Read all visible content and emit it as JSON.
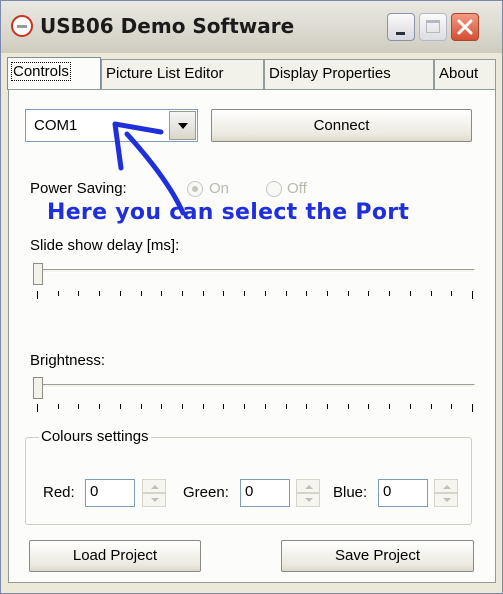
{
  "window": {
    "title": "USB06 Demo Software",
    "controls": {
      "minimize_icon": "minimize-icon",
      "maximize_icon": "maximize-icon",
      "close_icon": "close-icon"
    }
  },
  "tabs": [
    {
      "label": "Controls",
      "active": true
    },
    {
      "label": "Picture List Editor",
      "active": false
    },
    {
      "label": "Display Properties",
      "active": false
    },
    {
      "label": "About",
      "active": false
    }
  ],
  "port": {
    "selected": "COM1",
    "connect_label": "Connect"
  },
  "power_saving": {
    "label": "Power Saving:",
    "on_label": "On",
    "off_label": "Off",
    "selected": "On",
    "enabled": false
  },
  "annotation": {
    "text": "Here you can select the Port",
    "color": "#1f2fdc"
  },
  "slideshow": {
    "label": "Slide show delay [ms]:",
    "value_fraction": 0
  },
  "brightness": {
    "label": "Brightness:",
    "value_fraction": 0
  },
  "colours": {
    "title": "Colours settings",
    "red": {
      "label": "Red:",
      "value": "0"
    },
    "green": {
      "label": "Green:",
      "value": "0"
    },
    "blue": {
      "label": "Blue:",
      "value": "0"
    }
  },
  "buttons": {
    "load_label": "Load Project",
    "save_label": "Save Project"
  },
  "colors": {
    "window_bg": "#ece9d8",
    "panel_bg": "#fcfcfb",
    "close_button": "#d44f32",
    "annotation_blue": "#1f2fdc"
  }
}
